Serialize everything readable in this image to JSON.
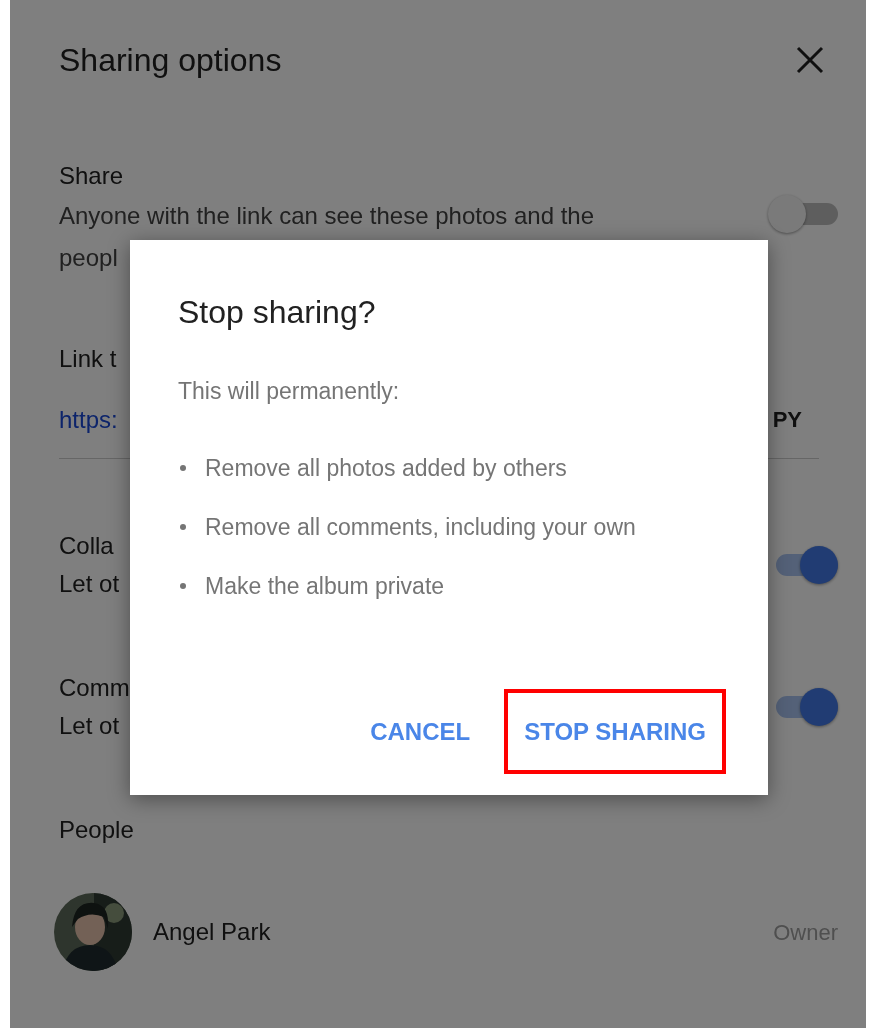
{
  "panel": {
    "title": "Sharing options",
    "share": {
      "label": "Share",
      "description": [
        "Anyone with the link can see these photos and the",
        "peopl"
      ],
      "on": false
    },
    "link": {
      "label": "Link t",
      "url": "https:",
      "copy": "PY"
    },
    "settings": [
      {
        "label": "Colla",
        "description": "Let ot",
        "on": true
      },
      {
        "label": "Comm",
        "description": "Let ot",
        "on": true
      }
    ],
    "people": {
      "label": "People",
      "members": [
        {
          "name": "Angel Park",
          "role": "Owner"
        }
      ]
    }
  },
  "dialog": {
    "title": "Stop sharing?",
    "intro": "This will permanently:",
    "items": [
      "Remove all photos added by others",
      "Remove all comments, including your own",
      "Make the album private"
    ],
    "buttons": [
      {
        "label": "CANCEL",
        "highlighted": false
      },
      {
        "label": "STOP SHARING",
        "highlighted": true
      }
    ]
  }
}
